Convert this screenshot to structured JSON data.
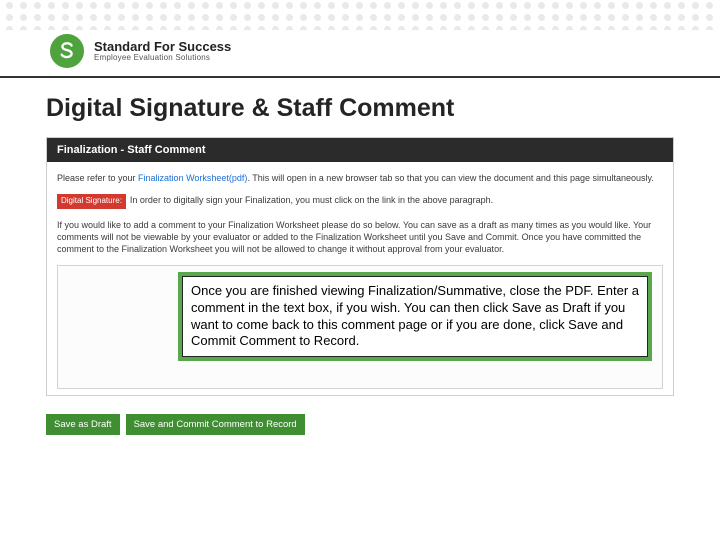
{
  "brand": {
    "name": "Standard For Success",
    "tagline": "Employee Evaluation Solutions"
  },
  "slide": {
    "title": "Digital Signature & Staff Comment"
  },
  "panel": {
    "header": "Finalization - Staff Comment",
    "para1_pre": "Please refer to your ",
    "para1_link": "Finalization Worksheet(pdf)",
    "para1_post": ".  This will open in a new browser tab so that you can view the document and this page simultaneously.",
    "digital_signature_label": "Digital Signature:",
    "para2": "In order to digitally sign your Finalization, you must click on the link in the above paragraph.",
    "para3": "If you would like to add a comment to your Finalization Worksheet please do so below. You can save as a draft as many times as you would like. Your comments will not be viewable by your evaluator or added to the Finalization Worksheet until you Save and Commit. Once you have committed the comment to the Finalization Worksheet you will not be allowed to change it without approval from your evaluator."
  },
  "callout": {
    "text": "Once you are finished viewing Finalization/Summative, close the PDF.  Enter a comment in the text box, if you wish.  You can then click Save as Draft if you want to come back to this comment page or if you are done, click Save and Commit Comment to Record."
  },
  "buttons": {
    "save_draft": "Save as Draft",
    "save_commit": "Save and Commit Comment to Record"
  }
}
